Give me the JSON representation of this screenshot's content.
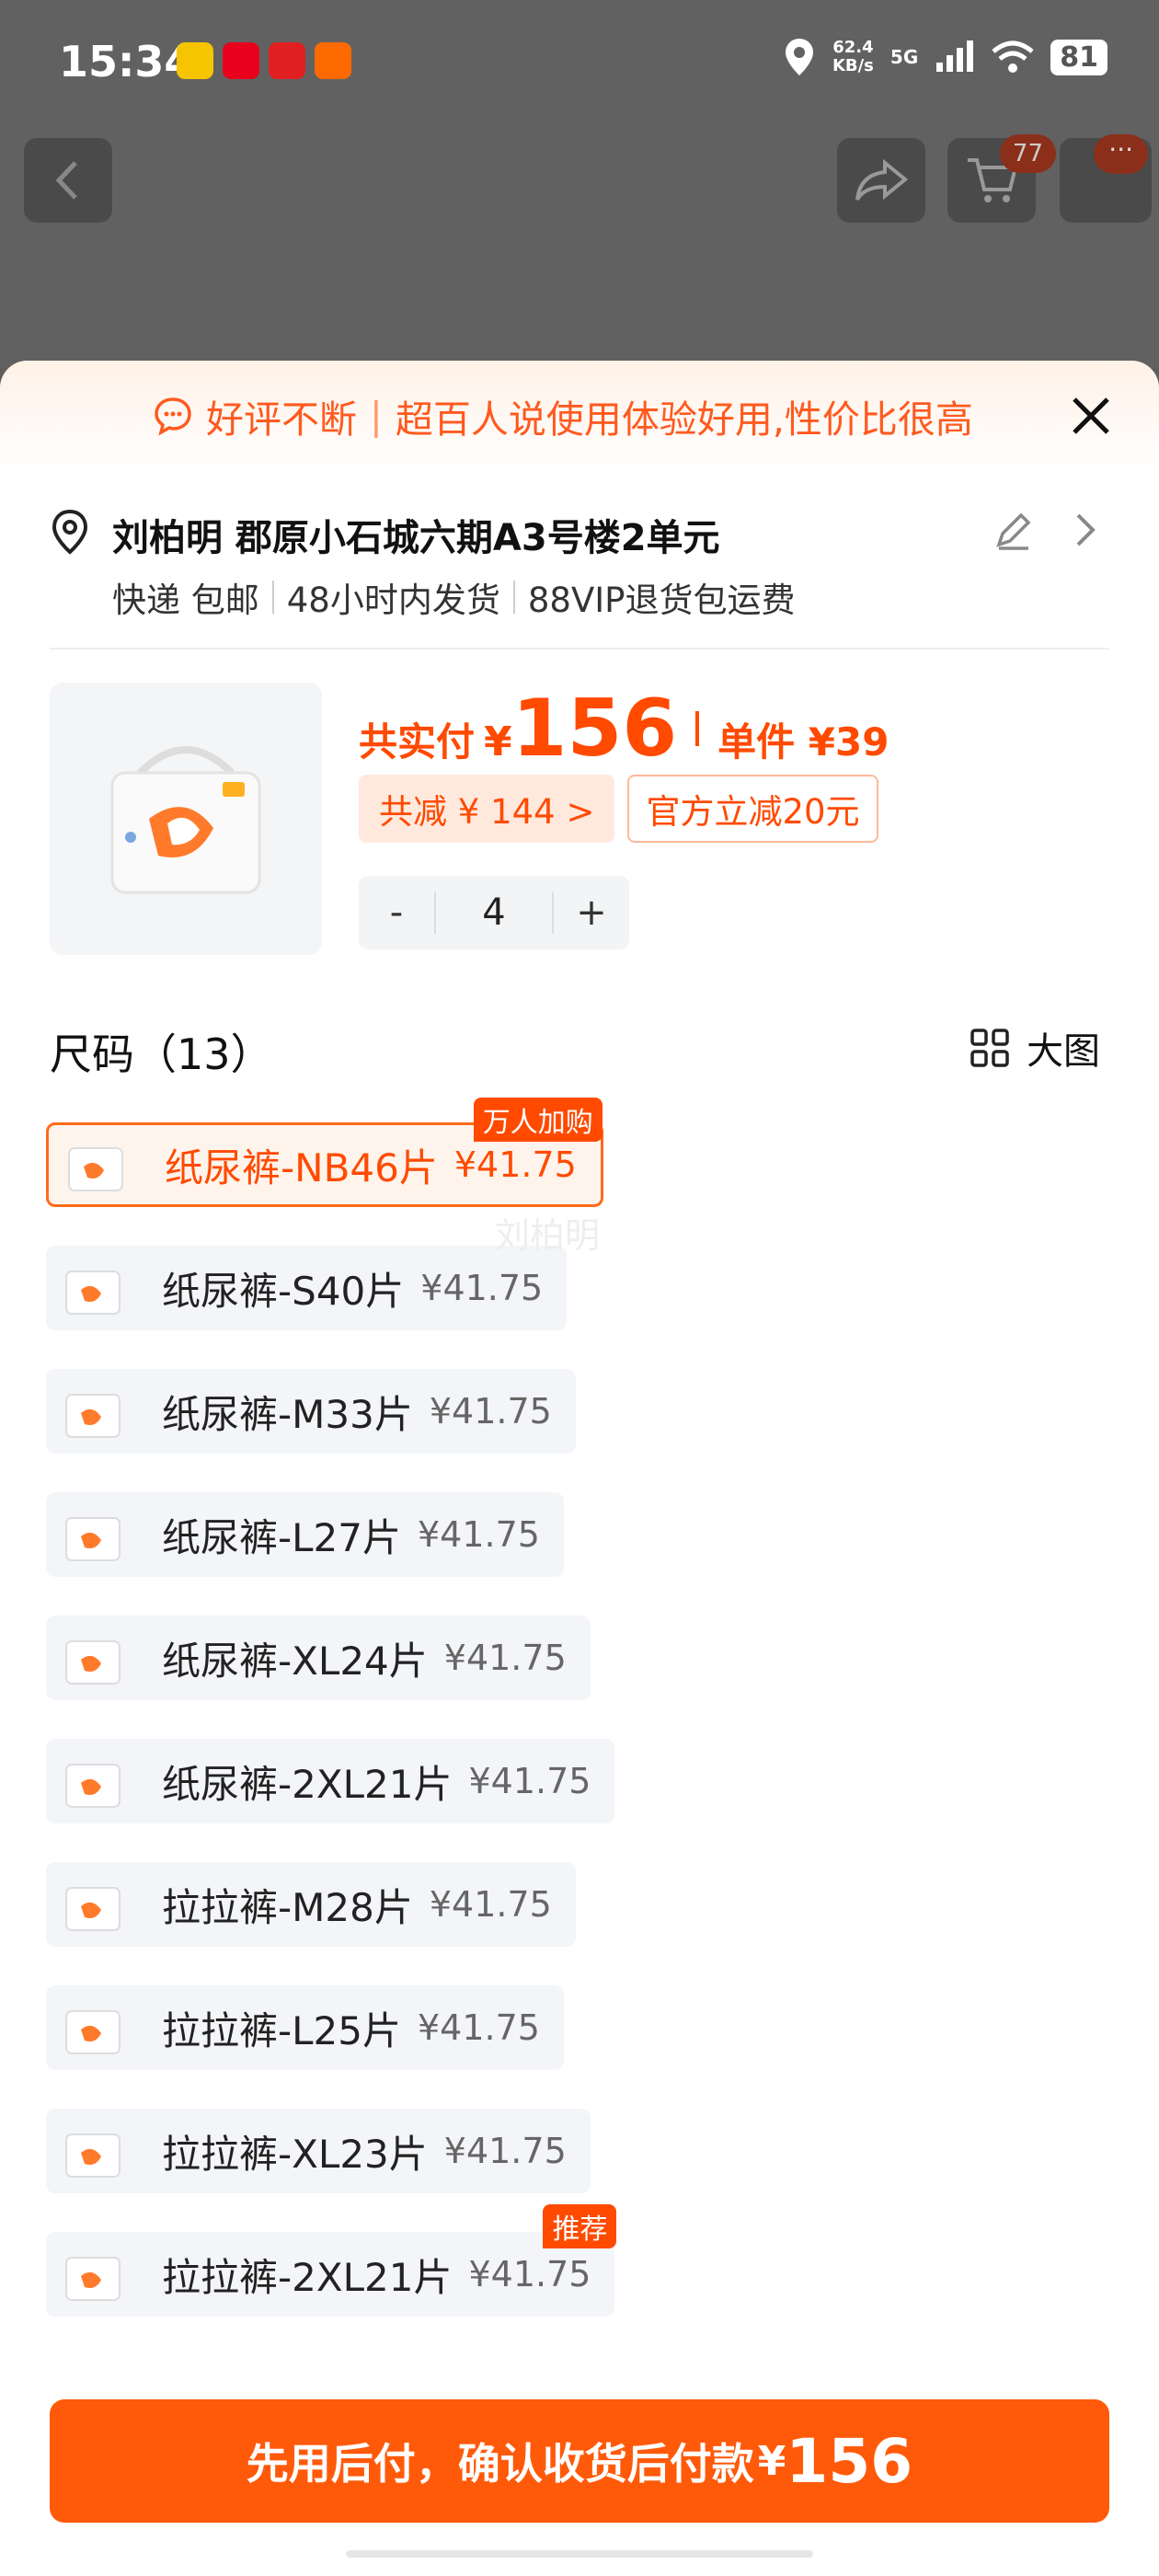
{
  "status": {
    "time": "15:34",
    "speed_value": "62.4",
    "speed_unit": "KB/s",
    "network": "5G",
    "battery": "81",
    "app_icon_colors": [
      "#f6c400",
      "#e8001c",
      "#e02020",
      "#ff6a00"
    ]
  },
  "top": {
    "cart_badge": "77",
    "more_badge": "···"
  },
  "banner": {
    "part1": "好评不断",
    "part2": "超百人说使用体验好用,性价比很高"
  },
  "address": {
    "name_line": "刘柏明 郡原小石城六期A3号楼2单元",
    "shipping": [
      "快递 包邮",
      "48小时内发货",
      "88VIP退货包运费"
    ]
  },
  "product": {
    "total_label": "共实付",
    "currency": "¥",
    "total_amount": "156",
    "unit_label": "单件 ¥39",
    "discount_chip": "共减 ¥ 144 >",
    "official_chip": "官方立减20元",
    "quantity": "4",
    "minus": "-",
    "plus": "+"
  },
  "sizes": {
    "header": "尺码（13）",
    "bigpic_label": "大图",
    "watermark": "刘柏明",
    "options": [
      {
        "name": "纸尿裤-NB46片",
        "price": "¥41.75",
        "tag": "万人加购",
        "selected": true
      },
      {
        "name": "纸尿裤-S40片",
        "price": "¥41.75",
        "tag": ""
      },
      {
        "name": "纸尿裤-M33片",
        "price": "¥41.75",
        "tag": ""
      },
      {
        "name": "纸尿裤-L27片",
        "price": "¥41.75",
        "tag": ""
      },
      {
        "name": "纸尿裤-XL24片",
        "price": "¥41.75",
        "tag": ""
      },
      {
        "name": "纸尿裤-2XL21片",
        "price": "¥41.75",
        "tag": ""
      },
      {
        "name": "拉拉裤-M28片",
        "price": "¥41.75",
        "tag": ""
      },
      {
        "name": "拉拉裤-L25片",
        "price": "¥41.75",
        "tag": ""
      },
      {
        "name": "拉拉裤-XL23片",
        "price": "¥41.75",
        "tag": ""
      },
      {
        "name": "拉拉裤-2XL21片",
        "price": "¥41.75",
        "tag": "推荐"
      }
    ]
  },
  "footer": {
    "cta_text": "先用后付，确认收货后付款",
    "cta_currency": "¥",
    "cta_amount": "156"
  },
  "colors": {
    "accent": "#ff4a00",
    "cta_bg": "#ff5a0a"
  }
}
